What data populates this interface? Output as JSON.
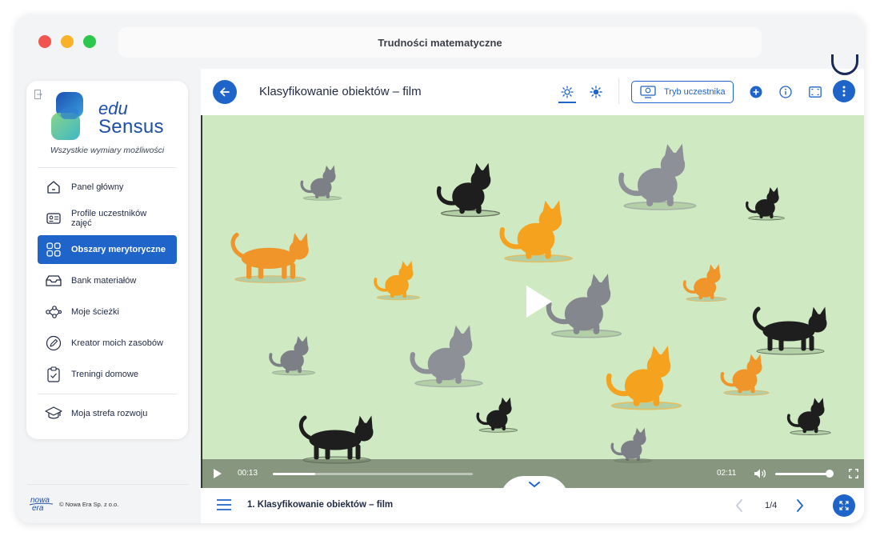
{
  "window": {
    "title": "Trudności matematyczne"
  },
  "sidebar": {
    "logo_edu": "edu",
    "logo_sensus": "Sensus",
    "tagline": "Wszystkie wymiary możliwości",
    "items": [
      {
        "label": "Panel główny",
        "icon": "home-icon",
        "active": false
      },
      {
        "label": "Profile uczestników zajęć",
        "icon": "id-card-icon",
        "active": false
      },
      {
        "label": "Obszary merytoryczne",
        "icon": "grid-icon",
        "active": true
      },
      {
        "label": "Bank materiałów",
        "icon": "inbox-icon",
        "active": false
      },
      {
        "label": "Moje ścieżki",
        "icon": "share-nodes-icon",
        "active": false
      },
      {
        "label": "Kreator moich zasobów",
        "icon": "pencil-icon",
        "active": false
      },
      {
        "label": "Treningi domowe",
        "icon": "clipboard-check-icon",
        "active": false
      },
      {
        "label": "Moja strefa rozwoju",
        "icon": "graduation-cap-icon",
        "active": false
      }
    ],
    "footer": {
      "brand_top": "nowa",
      "brand_bottom": "era",
      "copyright": "© Nowa Era Sp. z o.o."
    }
  },
  "topbar": {
    "title": "Klasyfikowanie obiektów – film",
    "mode_button": "Tryb uczestnika"
  },
  "player": {
    "current_time": "00:13",
    "duration": "02:11",
    "progress": 0.21,
    "volume": 1.0
  },
  "bottombar": {
    "slide_title": "1. Klasyfikowanie obiektów – film",
    "page_indicator": "1/4"
  },
  "colors": {
    "accent": "#1f64c8",
    "video_bg": "#cfe9c2",
    "text": "#1f2a44"
  }
}
